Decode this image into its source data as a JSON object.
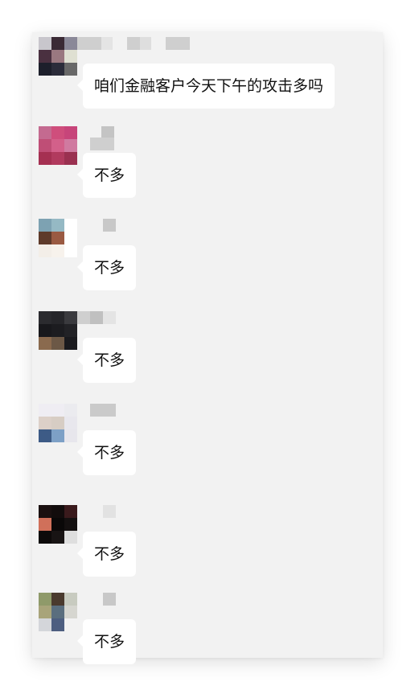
{
  "chat": {
    "messages": [
      {
        "text": "咱们金融客户今天下午的攻击多吗"
      },
      {
        "text": "不多"
      },
      {
        "text": "不多"
      },
      {
        "text": "不多"
      },
      {
        "text": "不多"
      },
      {
        "text": "不多"
      },
      {
        "text": "不多"
      }
    ]
  },
  "colors": {
    "chat_background": "#f2f2f2",
    "bubble_background": "#ffffff",
    "text": "#111111"
  },
  "icons": {
    "avatar": "pixelated-avatar",
    "sender_name": "pixelated-sender-name"
  }
}
